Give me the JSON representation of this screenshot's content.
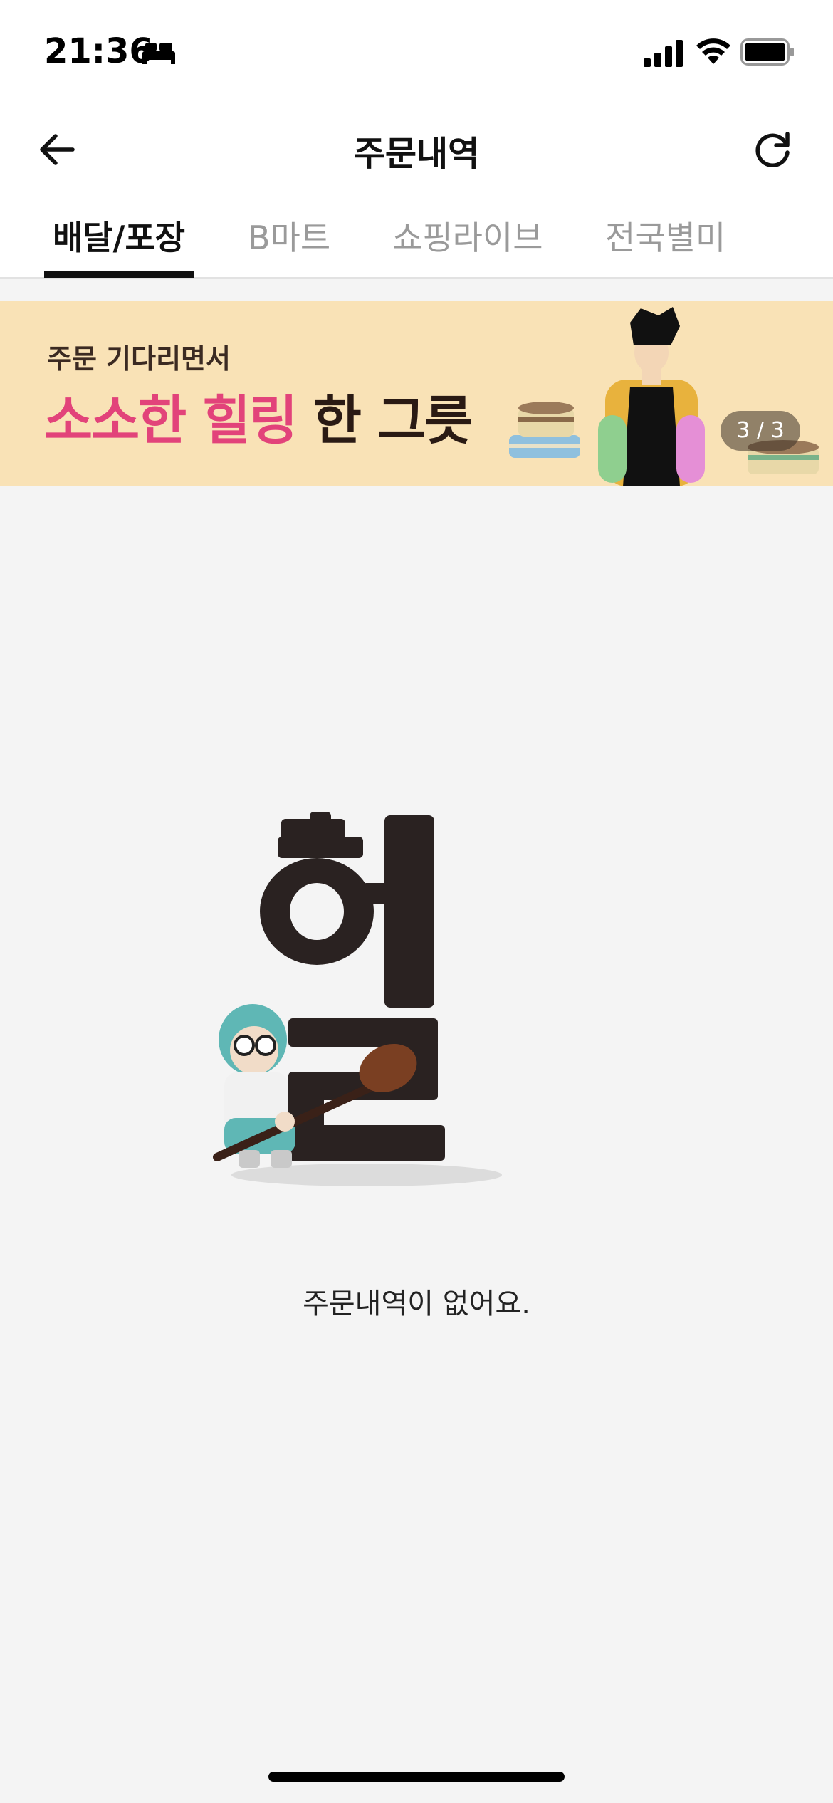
{
  "status_bar": {
    "time": "21:36"
  },
  "header": {
    "title": "주문내역"
  },
  "tabs": [
    {
      "label": "배달/포장",
      "active": true
    },
    {
      "label": "B마트",
      "active": false
    },
    {
      "label": "쇼핑라이브",
      "active": false
    },
    {
      "label": "전국별미",
      "active": false
    }
  ],
  "banner": {
    "subtitle": "주문 기다리면서",
    "title_highlight": "소소한 힐링",
    "title_rest": " 한 그릇",
    "counter": "3 / 3",
    "background_color": "#f9e2b6",
    "highlight_color": "#e2437a"
  },
  "empty_state": {
    "message": "주문내역이 없어요."
  },
  "icons": [
    "bed-icon",
    "signal-icon",
    "wifi-icon",
    "battery-icon",
    "back-arrow-icon",
    "refresh-icon"
  ]
}
